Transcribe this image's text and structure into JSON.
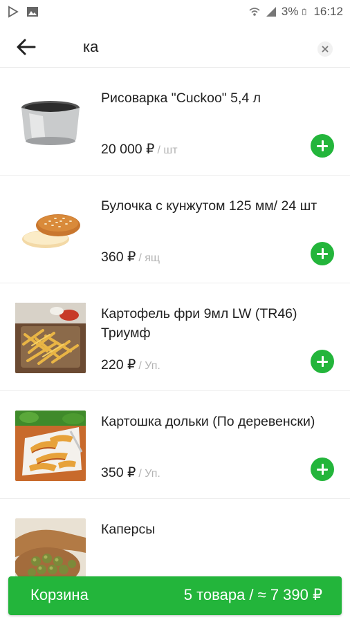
{
  "status_bar": {
    "battery_percent": "3%",
    "time": "16:12"
  },
  "search": {
    "query": "ка"
  },
  "products": [
    {
      "name": "Рисоварка \"Cuckoo\" 5,4 л",
      "price": "20 000 ₽",
      "unit": "/ шт",
      "image": "rice-cooker"
    },
    {
      "name": "Булочка с кунжутом 125 мм/ 24 шт",
      "price": "360 ₽",
      "unit": "/ ящ",
      "image": "sesame-bun"
    },
    {
      "name": "Картофель фри 9мл LW (TR46) Триумф",
      "price": "220 ₽",
      "unit": "/ Уп.",
      "image": "french-fries"
    },
    {
      "name": "Картошка дольки (По деревенски)",
      "price": "350 ₽",
      "unit": "/ Уп.",
      "image": "potato-wedges"
    },
    {
      "name": "Каперсы",
      "price": "",
      "unit": "",
      "image": "capers"
    }
  ],
  "cart": {
    "label": "Корзина",
    "summary": "5 товара / ≈ 7 390 ₽"
  },
  "colors": {
    "accent": "#23b53b"
  }
}
